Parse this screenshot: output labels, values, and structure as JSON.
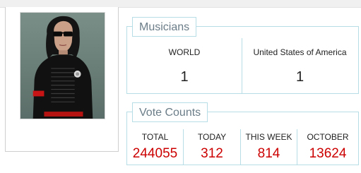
{
  "musicians": {
    "title": "Musicians",
    "columns": [
      {
        "label": "WORLD",
        "value": "1"
      },
      {
        "label": "United States of America",
        "value": "1"
      }
    ]
  },
  "votes": {
    "title": "Vote Counts",
    "columns": [
      {
        "label": "TOTAL",
        "value": "244055"
      },
      {
        "label": "TODAY",
        "value": "312"
      },
      {
        "label": "THIS WEEK",
        "value": "814"
      },
      {
        "label": "OCTOBER",
        "value": "13624"
      }
    ],
    "value_color": "#cc0000"
  },
  "colors": {
    "panel_border": "#b7dde6",
    "legend_text": "#6b7d88"
  },
  "photo": {
    "icon": "artist-photo"
  }
}
